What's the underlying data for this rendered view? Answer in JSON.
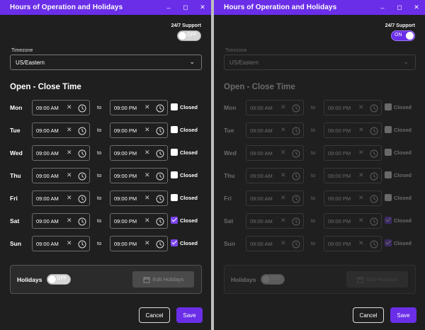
{
  "window_title": "Hours of Operation and Holidays",
  "window_controls": {
    "minimize": "–",
    "maximize": "◻",
    "close": "✕"
  },
  "support_label": "24/7 Support",
  "toggle_off": "OFF",
  "toggle_on": "ON",
  "timezone_label": "Timezone",
  "timezone_value": "US/Eastern",
  "section_title": "Open - Close Time",
  "to_label": "to",
  "closed_label": "Closed",
  "clear_glyph": "✕",
  "days": [
    {
      "day": "Mon",
      "open": "09:00 AM",
      "close": "09:00 PM",
      "closed": false
    },
    {
      "day": "Tue",
      "open": "09:00 AM",
      "close": "09:00 PM",
      "closed": false
    },
    {
      "day": "Wed",
      "open": "09:00 AM",
      "close": "09:00 PM",
      "closed": false
    },
    {
      "day": "Thu",
      "open": "09:00 AM",
      "close": "09:00 PM",
      "closed": false
    },
    {
      "day": "Fri",
      "open": "09:00 AM",
      "close": "09:00 PM",
      "closed": false
    },
    {
      "day": "Sat",
      "open": "09:00 AM",
      "close": "09:00 PM",
      "closed": true
    },
    {
      "day": "Sun",
      "open": "09:00 AM",
      "close": "09:00 PM",
      "closed": true
    }
  ],
  "holidays_label": "Holidays",
  "edit_holidays_label": "Edit Holidays",
  "cancel_label": "Cancel",
  "save_label": "Save",
  "colors": {
    "accent": "#6a2ee8",
    "background": "#1f1f1f",
    "checked": "#7b45f0"
  },
  "panels": [
    {
      "support_on": false
    },
    {
      "support_on": true
    }
  ]
}
